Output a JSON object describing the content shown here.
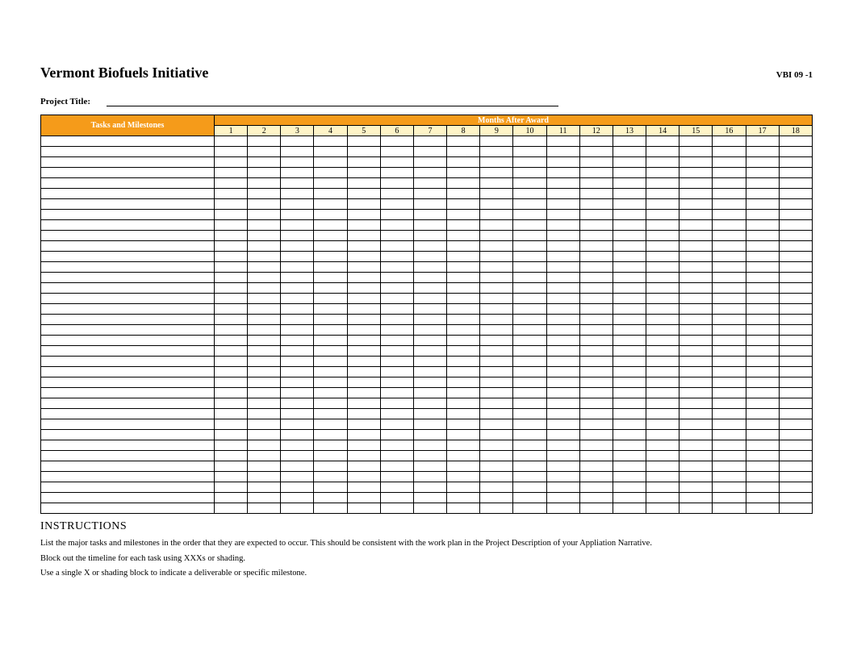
{
  "header": {
    "title": "Vermont Biofuels Initiative",
    "code": "VBI 09 -1"
  },
  "project": {
    "label": "Project Title:",
    "value": ""
  },
  "table": {
    "tasks_header": "Tasks and Milestones",
    "months_header": "Months After Award",
    "month_numbers": [
      "1",
      "2",
      "3",
      "4",
      "5",
      "6",
      "7",
      "8",
      "9",
      "10",
      "11",
      "12",
      "13",
      "14",
      "15",
      "16",
      "17",
      "18"
    ],
    "row_count": 36
  },
  "instructions": {
    "title": "INSTRUCTIONS",
    "lines": [
      "List the major tasks and milestones in the order that they are expected to occur. This should be consistent with the work plan in the Project Description of your Appliation Narrative.",
      "Block out the timeline for each task using XXXs or shading.",
      "Use a single X or shading block to indicate a deliverable or specific milestone."
    ]
  }
}
